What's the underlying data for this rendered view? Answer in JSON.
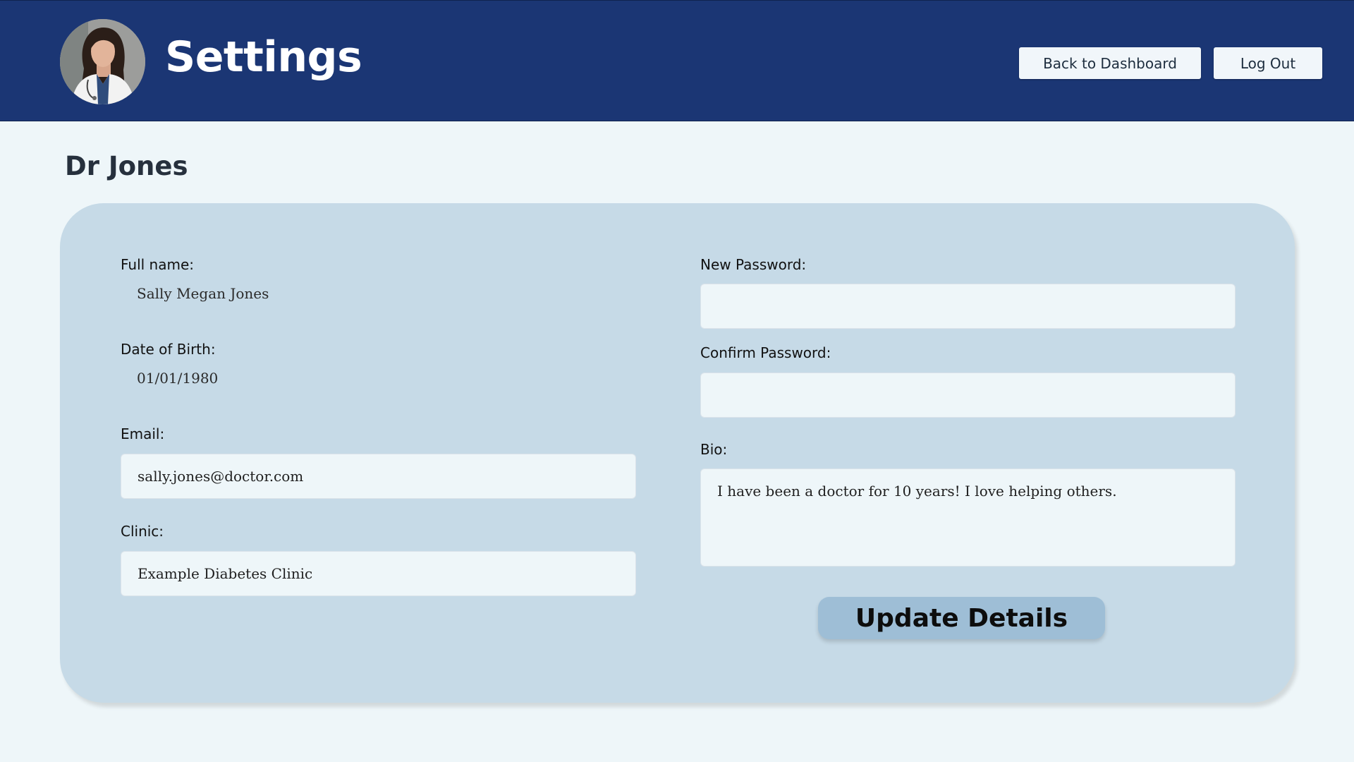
{
  "header": {
    "title": "Settings",
    "avatar_alt": "Doctor profile photo",
    "back_button_label": "Back to Dashboard",
    "logout_button_label": "Log Out"
  },
  "profile": {
    "display_name": "Dr Jones"
  },
  "form": {
    "full_name_label": "Full name:",
    "full_name_value": "Sally Megan Jones",
    "dob_label": "Date of Birth:",
    "dob_value": "01/01/1980",
    "email_label": "Email:",
    "email_value": "sally.jones@doctor.com",
    "clinic_label": "Clinic:",
    "clinic_value": "Example Diabetes Clinic",
    "new_password_label": "New Password:",
    "new_password_value": "",
    "confirm_password_label": "Confirm Password:",
    "confirm_password_value": "",
    "bio_label": "Bio:",
    "bio_value": "I have been a doctor for 10 years! I love helping others.",
    "submit_label": "Update Details"
  },
  "colors": {
    "header_bg": "#1b3674",
    "page_bg": "#eef6f9",
    "card_bg": "#c6dae7",
    "button_accent": "#9ebed6"
  }
}
